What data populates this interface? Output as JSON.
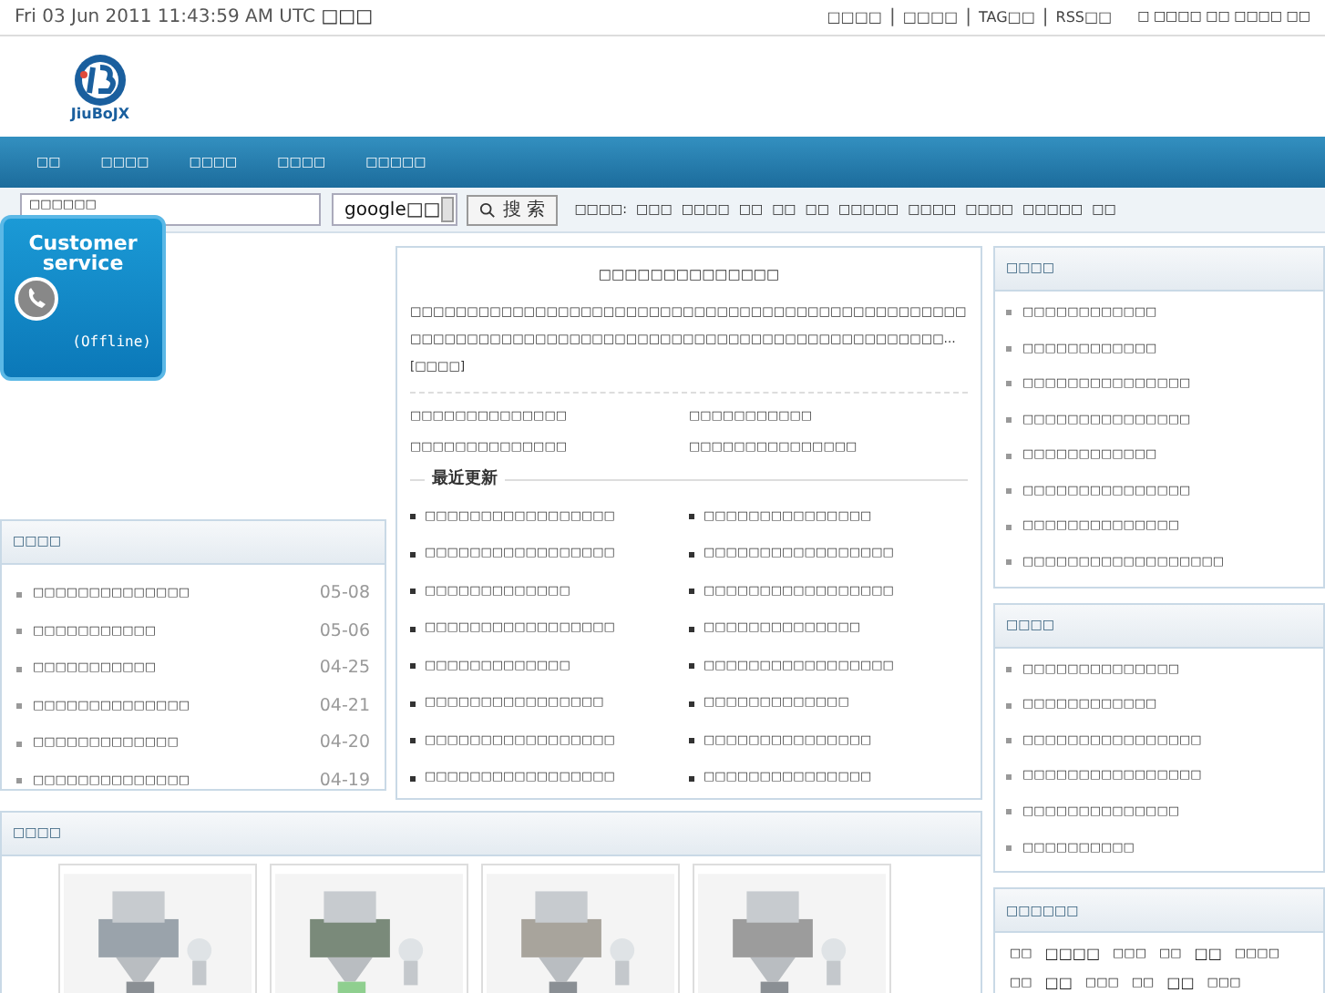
{
  "topbar": {
    "datetime": "Fri 03 Jun 2011 11:43:59 AM UTC",
    "datetime_suffix": "□□□",
    "links": [
      "□□□□",
      "□□□□",
      "TAG□□",
      "RSS□□"
    ],
    "separator": "|",
    "extra": "□ □□□□ □□ □□□□ □□"
  },
  "logo": {
    "text": "JiuBoJX"
  },
  "nav": [
    "□□",
    "□□□□",
    "□□□□",
    "□□□□",
    "□□□□□"
  ],
  "search": {
    "value": "□□□□□□",
    "engine": "google□□",
    "button": "搜 索",
    "hot_label": "□□□□:",
    "hot_tags": [
      "□□□",
      "□□□□",
      "□□",
      "□□",
      "□□",
      "□□□□□",
      "□□□□",
      "□□□□",
      "□□□□□",
      "□□"
    ]
  },
  "customer_service": {
    "title": "Customer service",
    "status": "(Offline)"
  },
  "intro": {
    "title": "□□□□□□□□□□□□□□",
    "text": "□□□□□□□□□□□□□□□□□□□□□□□□□□□□□□□□□□□□□□□□□□□□□□□□□□□□□□□□□□□□□□□□□□□□□□□□□□□□□□□□□□□□□□□□□□□□□□□□…[□□□□]",
    "links": [
      "□□□□□□□□□□□□□□",
      "□□□□□□□□□□□",
      "□□□□□□□□□□□□□□",
      "□□□□□□□□□□□□□□□"
    ]
  },
  "recent": {
    "title": "最近更新",
    "items": [
      "□□□□□□□□□□□□□□□□□",
      "□□□□□□□□□□□□□□□",
      "□□□□□□□□□□□□□□□□□",
      "□□□□□□□□□□□□□□□□□",
      "□□□□□□□□□□□□□",
      "□□□□□□□□□□□□□□□□□",
      "□□□□□□□□□□□□□□□□□",
      "□□□□□□□□□□□□□□",
      "□□□□□□□□□□□□□",
      "□□□□□□□□□□□□□□□□□",
      "□□□□□□□□□□□□□□□□",
      "□□□□□□□□□□□□□",
      "□□□□□□□□□□□□□□□□□",
      "□□□□□□□□□□□□□□□",
      "□□□□□□□□□□□□□□□□□",
      "□□□□□□□□□□□□□□□"
    ]
  },
  "news": {
    "title": "□□□□",
    "items": [
      {
        "text": "□□□□□□□□□□□□□□",
        "date": "05-08"
      },
      {
        "text": "□□□□□□□□□□□",
        "date": "05-06"
      },
      {
        "text": "□□□□□□□□□□□",
        "date": "04-25"
      },
      {
        "text": "□□□□□□□□□□□□□□",
        "date": "04-21"
      },
      {
        "text": "□□□□□□□□□□□□□",
        "date": "04-20"
      },
      {
        "text": "□□□□□□□□□□□□□□",
        "date": "04-19"
      }
    ]
  },
  "products": {
    "title": "□□□□"
  },
  "side_panels": [
    {
      "title": "□□□□",
      "items": [
        "□□□□□□□□□□□□",
        "□□□□□□□□□□□□",
        "□□□□□□□□□□□□□□□",
        "□□□□□□□□□□□□□□□",
        "□□□□□□□□□□□□",
        "□□□□□□□□□□□□□□□",
        "□□□□□□□□□□□□□□",
        "□□□□□□□□□□□□□□□□□□"
      ]
    },
    {
      "title": "□□□□",
      "items": [
        "□□□□□□□□□□□□□□",
        "□□□□□□□□□□□□",
        "□□□□□□□□□□□□□□□□",
        "□□□□□□□□□□□□□□□□",
        "□□□□□□□□□□□□□□",
        "□□□□□□□□□□"
      ]
    }
  ],
  "tag_cloud": {
    "title": "□□□□□□",
    "tags": [
      "□□",
      "□□□□",
      "□□□",
      "□□",
      "□□",
      "□□□□",
      "□□",
      "□□",
      "□□□",
      "□□",
      "□□",
      "□□□"
    ]
  }
}
